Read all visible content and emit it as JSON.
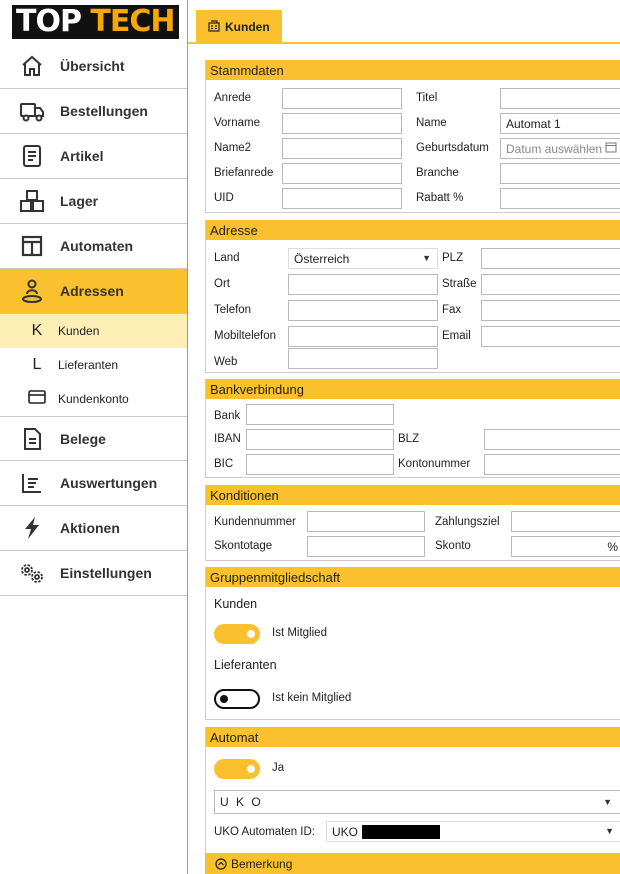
{
  "app": {
    "logo_part1": "TOP",
    "logo_part2": "TECH"
  },
  "sidebar": {
    "items": [
      {
        "label": "Übersicht",
        "icon": "home-icon"
      },
      {
        "label": "Bestellungen",
        "icon": "truck-icon"
      },
      {
        "label": "Artikel",
        "icon": "document-icon"
      },
      {
        "label": "Lager",
        "icon": "boxes-icon"
      },
      {
        "label": "Automaten",
        "icon": "columns-icon"
      },
      {
        "label": "Adressen",
        "icon": "location-person-icon",
        "active": true
      },
      {
        "label": "Belege",
        "icon": "file-icon"
      },
      {
        "label": "Auswertungen",
        "icon": "report-icon"
      },
      {
        "label": "Aktionen",
        "icon": "lightning-icon"
      },
      {
        "label": "Einstellungen",
        "icon": "gears-icon"
      }
    ],
    "subitems": [
      {
        "glyph": "K",
        "label": "Kunden",
        "active": true
      },
      {
        "glyph": "L",
        "label": "Lieferanten"
      },
      {
        "glyph": "▭",
        "label": "Kundenkonto",
        "icon": "card-icon"
      }
    ]
  },
  "tab": {
    "label": "Kunden",
    "icon": "building-icon"
  },
  "stammdaten": {
    "title": "Stammdaten",
    "anrede_label": "Anrede",
    "anrede_value": "",
    "titel_label": "Titel",
    "titel_value": "",
    "vorname_label": "Vorname",
    "vorname_value": "",
    "name_label": "Name",
    "name_value": "Automat 1",
    "name2_label": "Name2",
    "name2_value": "",
    "geburtsdatum_label": "Geburtsdatum",
    "geburtsdatum_placeholder": "Datum auswählen",
    "briefanrede_label": "Briefanrede",
    "briefanrede_value": "",
    "branche_label": "Branche",
    "branche_value": "",
    "uid_label": "UID",
    "uid_value": "",
    "rabatt_label": "Rabatt %",
    "rabatt_value": ""
  },
  "adresse": {
    "title": "Adresse",
    "land_label": "Land",
    "land_value": "Österreich",
    "plz_label": "PLZ",
    "plz_value": "",
    "ort_label": "Ort",
    "ort_value": "",
    "strasse_label": "Straße",
    "strasse_value": "",
    "telefon_label": "Telefon",
    "telefon_value": "",
    "fax_label": "Fax",
    "fax_value": "",
    "mobil_label": "Mobiltelefon",
    "mobil_value": "",
    "email_label": "Email",
    "email_value": "",
    "web_label": "Web",
    "web_value": ""
  },
  "bank": {
    "title": "Bankverbindung",
    "bank_label": "Bank",
    "bank_value": "",
    "iban_label": "IBAN",
    "iban_value": "",
    "blz_label": "BLZ",
    "blz_value": "",
    "bic_label": "BIC",
    "bic_value": "",
    "konto_label": "Kontonummer",
    "konto_value": ""
  },
  "konditionen": {
    "title": "Konditionen",
    "kundennr_label": "Kundennummer",
    "kundennr_value": "",
    "zahlungsziel_label": "Zahlungsziel",
    "zahlungsziel_value": "",
    "skontotage_label": "Skontotage",
    "skontotage_value": "",
    "skonto_label": "Skonto",
    "skonto_value": "%"
  },
  "gruppen": {
    "title": "Gruppenmitgliedschaft",
    "kunden_label": "Kunden",
    "kunden_toggle_label": "Ist Mitglied",
    "kunden_on": true,
    "lieferanten_label": "Lieferanten",
    "lieferanten_toggle_label": "Ist kein Mitglied",
    "lieferanten_on": false
  },
  "automat": {
    "title": "Automat",
    "toggle_label": "Ja",
    "toggle_on": true,
    "select_value": "U K O",
    "id_label": "UKO Automaten ID:",
    "id_value": "UKO"
  },
  "bemerkung": {
    "label": "Bemerkung"
  },
  "colors": {
    "accent": "#fbc02d",
    "accent_light": "#fdeeb6"
  }
}
